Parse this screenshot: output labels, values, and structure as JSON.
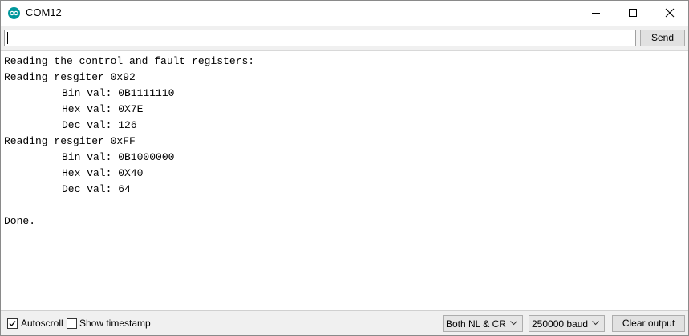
{
  "window": {
    "title": "COM12"
  },
  "input": {
    "value": "",
    "send_label": "Send"
  },
  "output": {
    "lines": [
      {
        "text": "Reading the control and fault registers:",
        "indent": false
      },
      {
        "text": "Reading resgiter 0x92",
        "indent": false
      },
      {
        "text": "Bin val: 0B1111110",
        "indent": true
      },
      {
        "text": "Hex val: 0X7E",
        "indent": true
      },
      {
        "text": "Dec val: 126",
        "indent": true
      },
      {
        "text": "Reading resgiter 0xFF",
        "indent": false
      },
      {
        "text": "Bin val: 0B1000000",
        "indent": true
      },
      {
        "text": "Hex val: 0X40",
        "indent": true
      },
      {
        "text": "Dec val: 64",
        "indent": true
      },
      {
        "text": "",
        "indent": false
      },
      {
        "text": "Done.",
        "indent": false
      }
    ]
  },
  "footer": {
    "autoscroll_label": "Autoscroll",
    "autoscroll_checked": true,
    "timestamp_label": "Show timestamp",
    "timestamp_checked": false,
    "line_ending": "Both NL & CR",
    "baud_rate": "250000 baud",
    "clear_label": "Clear output"
  },
  "colors": {
    "app_icon": "#00979c"
  },
  "icons": {
    "app": "arduino-logo-icon",
    "minimize": "minimize-icon",
    "maximize": "maximize-icon",
    "close": "close-icon",
    "dropdown": "chevron-down-icon",
    "check": "checkmark-icon"
  }
}
